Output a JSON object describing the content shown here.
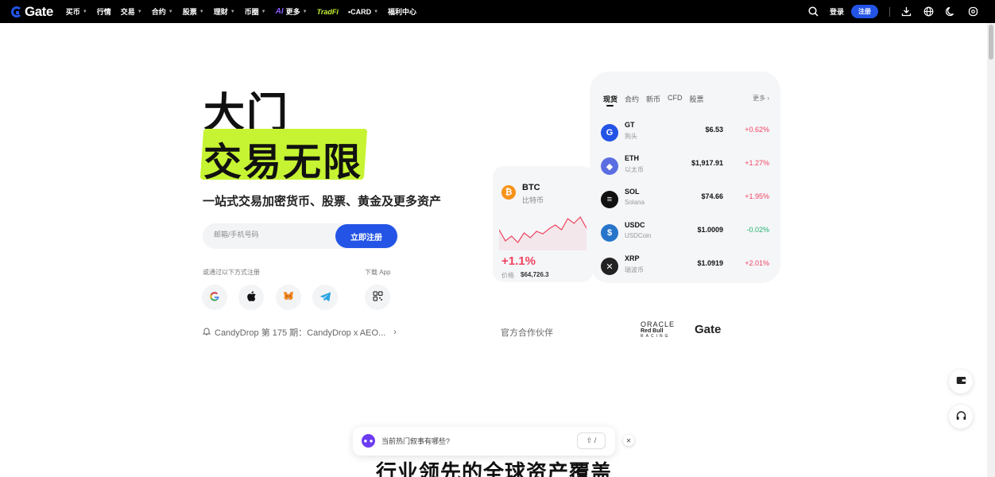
{
  "nav": {
    "logo_text": "Gate",
    "items": [
      {
        "label": "买币",
        "caret": true
      },
      {
        "label": "行情",
        "caret": false
      },
      {
        "label": "交易",
        "caret": true
      },
      {
        "label": "合约",
        "caret": true
      },
      {
        "label": "股票",
        "caret": true
      },
      {
        "label": "理财",
        "caret": true
      },
      {
        "label": "币圈",
        "caret": true
      }
    ],
    "ai_mark": "AI",
    "ai_label": "更多",
    "tradfi": "TradFi",
    "card": "•CARD",
    "rewards": "福利中心",
    "login": "登录",
    "signup": "注册"
  },
  "hero": {
    "title": "大门",
    "subtitle": "交易无限",
    "tagline": "一站式交易加密货币、股票、黄金及更多资产",
    "email_placeholder": "邮箱/手机号码",
    "register_button": "立即注册",
    "or_register_label": "或通过以下方式注册",
    "download_label": "下载 App",
    "candy_text": "CandyDrop 第 175 期：CandyDrop x AEO...",
    "partner_label": "官方合作伙伴",
    "partner_oracle_line1": "ORACLE",
    "partner_oracle_line2": "Red Bull",
    "partner_oracle_line3": "RACING",
    "partner_gate": "Gate"
  },
  "btc_card": {
    "symbol": "BTC",
    "name": "比特币",
    "icon": "₿",
    "change": "+1.1%",
    "price_label": "价格",
    "price": "$64,726.3",
    "spark": [
      0.55,
      0.2,
      0.35,
      0.15,
      0.45,
      0.3,
      0.5,
      0.42,
      0.58,
      0.7,
      0.55,
      0.9,
      0.75,
      0.95,
      0.6
    ]
  },
  "market": {
    "tabs": [
      "现货",
      "合约",
      "新币",
      "CFD",
      "股票"
    ],
    "active_tab": 0,
    "more": "更多 ›",
    "rows": [
      {
        "symbol": "GT",
        "name": "狗头",
        "price": "$6.53",
        "change": "+0.62%",
        "dir": "up",
        "color": "#2354e6",
        "icon": "G"
      },
      {
        "symbol": "ETH",
        "name": "以太币",
        "price": "$1,917.91",
        "change": "+1.27%",
        "dir": "up",
        "color": "#5b6ee1",
        "icon": "◆"
      },
      {
        "symbol": "SOL",
        "name": "Solana",
        "price": "$74.66",
        "change": "+1.95%",
        "dir": "up",
        "color": "#111111",
        "icon": "≡"
      },
      {
        "symbol": "USDC",
        "name": "USDCoin",
        "price": "$1.0009",
        "change": "-0.02%",
        "dir": "down",
        "color": "#2775ca",
        "icon": "$"
      },
      {
        "symbol": "XRP",
        "name": "瑞波币",
        "price": "$1.0919",
        "change": "+2.01%",
        "dir": "up",
        "color": "#222222",
        "icon": "✕"
      }
    ]
  },
  "ai_bar": {
    "prompt": "当前热门叙事有哪些?",
    "shortcut": "⇧ /"
  },
  "bottom_heading": "行业领先的全球资产覆盖"
}
